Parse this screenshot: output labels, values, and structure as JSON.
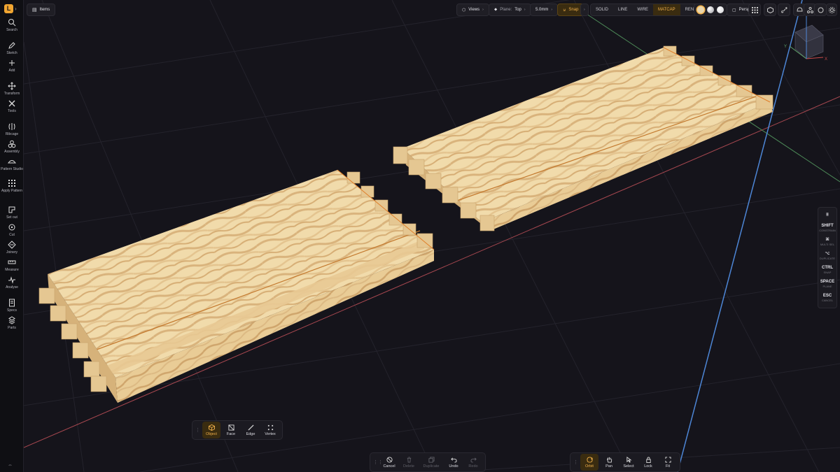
{
  "app": {
    "logo_letter": "L"
  },
  "sidebar": {
    "items": [
      {
        "label": "Search",
        "icon": "search-icon"
      },
      {
        "label": "Sketch",
        "icon": "pencil-icon"
      },
      {
        "label": "Add",
        "icon": "plus-icon"
      },
      {
        "label": "Transform",
        "icon": "move-icon"
      },
      {
        "label": "Tools",
        "icon": "tools-icon"
      },
      {
        "label": "Ribcage",
        "icon": "ribcage-icon"
      },
      {
        "label": "Assembly",
        "icon": "assembly-icon"
      },
      {
        "label": "Pattern Studio",
        "icon": "pattern-icon"
      },
      {
        "label": "Apply Pattern",
        "icon": "grid-icon"
      },
      {
        "label": "Set out",
        "icon": "setout-icon"
      },
      {
        "label": "Cut",
        "icon": "cut-icon"
      },
      {
        "label": "Joinery",
        "icon": "joinery-icon"
      },
      {
        "label": "Measure",
        "icon": "measure-icon"
      },
      {
        "label": "Analyse",
        "icon": "analyse-icon"
      },
      {
        "label": "Specs",
        "icon": "specs-icon"
      },
      {
        "label": "Parts",
        "icon": "parts-icon"
      }
    ],
    "bottom_icon": "collapse-icon"
  },
  "topbar": {
    "items_label": "Items",
    "views_label": "Views",
    "plane_label": "Plane:",
    "plane_value": "Top",
    "grid_value": "5.0mm",
    "snap_label": "Snap",
    "render_modes": [
      "SOLID",
      "LINE",
      "WIRE",
      "MATCAP",
      "RENDER"
    ],
    "active_mode": "MATCAP",
    "projection_label": "Persp",
    "matcap_colors": [
      "#e8d6ad",
      "#c9c9cf",
      "#f2f2f2"
    ]
  },
  "shortcuts": [
    {
      "key": "⠿",
      "desc": ""
    },
    {
      "key": "SHIFT",
      "desc": "CONSTRAIN"
    },
    {
      "key": "⌘",
      "desc": "MULTI SEL"
    },
    {
      "key": "⌥",
      "desc": "DUPLICATE"
    },
    {
      "key": "CTRL",
      "desc": "SNAP"
    },
    {
      "key": "SPACE",
      "desc": "PLANE"
    },
    {
      "key": "ESC",
      "desc": "CANCEL"
    }
  ],
  "selection_toolbar": {
    "items": [
      {
        "label": "Object",
        "icon": "cube-icon",
        "active": true
      },
      {
        "label": "Face",
        "icon": "face-icon",
        "active": false
      },
      {
        "label": "Edge",
        "icon": "edge-icon",
        "active": false
      },
      {
        "label": "Vertex",
        "icon": "vertex-icon",
        "active": false
      }
    ]
  },
  "edit_toolbar": {
    "items": [
      {
        "label": "Cancel",
        "icon": "cancel-icon",
        "disabled": false
      },
      {
        "label": "Delete",
        "icon": "trash-icon",
        "disabled": true
      },
      {
        "label": "Duplicate",
        "icon": "duplicate-icon",
        "disabled": true
      },
      {
        "label": "Undo",
        "icon": "undo-icon",
        "disabled": false
      },
      {
        "label": "Redo",
        "icon": "redo-icon",
        "disabled": true
      }
    ]
  },
  "nav_toolbar": {
    "items": [
      {
        "label": "Orbit",
        "icon": "orbit-icon",
        "active": true
      },
      {
        "label": "Pan",
        "icon": "hand-icon",
        "active": false
      },
      {
        "label": "Select",
        "icon": "cursor-icon",
        "active": false
      },
      {
        "label": "Lock",
        "icon": "lock-icon",
        "active": false
      },
      {
        "label": "Fit",
        "icon": "fit-icon",
        "active": false
      }
    ]
  },
  "viewcube": {
    "axes": [
      "X",
      "Y",
      "Z"
    ]
  },
  "colors": {
    "accent": "#f2b14a",
    "wood_light": "#f1d9a6",
    "wood_dark": "#d8b07a",
    "edge_highlight": "#f08a2a",
    "axis_x": "#b8484e",
    "axis_z": "#4d86d6",
    "axis_y": "#5fa36a"
  }
}
